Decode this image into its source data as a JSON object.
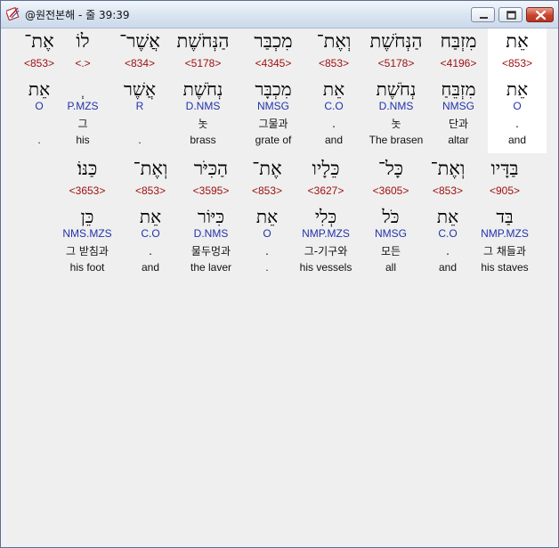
{
  "window": {
    "title": "@원전본해 - 줄 39:39",
    "colors": {
      "titlebar": "#dbe6f2",
      "content": "#efefef",
      "strong": "#a01010",
      "morph": "#2233aa"
    }
  },
  "rows": [
    {
      "words": [
        {
          "heb": "אֶת־",
          "strong": "<853>",
          "lemma": "אֵת",
          "morph": "O",
          "kor": "",
          "eng": ".",
          "selected": false
        },
        {
          "heb": "לוֹ",
          "strong": "<.>",
          "lemma": "ְ",
          "morph": "P.MZS",
          "kor": "그",
          "eng": "his",
          "selected": false
        },
        {
          "heb": "אֲשֶׁר־",
          "strong": "<834>",
          "lemma": "אֲשֶׁר",
          "morph": "R",
          "kor": "",
          "eng": ".",
          "selected": false
        },
        {
          "heb": "הַנְּחֹשֶׁת",
          "strong": "<5178>",
          "lemma": "נְחֹשֶׁת",
          "morph": "D.NMS",
          "kor": "놋",
          "eng": "brass",
          "selected": false
        },
        {
          "heb": "מִכְבַּר",
          "strong": "<4345>",
          "lemma": "מִכְבָּר",
          "morph": "NMSG",
          "kor": "그물과",
          "eng": "grate of",
          "selected": false
        },
        {
          "heb": "וְאֶת־",
          "strong": "<853>",
          "lemma": "אֵת",
          "morph": "C.O",
          "kor": ".",
          "eng": "and",
          "selected": false
        },
        {
          "heb": "הַנְּחֹשֶׁת",
          "strong": "<5178>",
          "lemma": "נְחֹשֶׁת",
          "morph": "D.NMS",
          "kor": "놋",
          "eng": "The brasen",
          "selected": false
        },
        {
          "heb": "מִזְבַּח",
          "strong": "<4196>",
          "lemma": "מִזְבֵּחַ",
          "morph": "NMSG",
          "kor": "단과",
          "eng": "altar",
          "selected": false
        },
        {
          "heb": "אֵת",
          "strong": "<853>",
          "lemma": "אֵת",
          "morph": "O",
          "kor": ".",
          "eng": "and",
          "selected": true
        }
      ]
    },
    {
      "words": [
        {
          "heb": "כַּנּוֹ׃",
          "strong": "<3653>",
          "lemma": "כֵּן",
          "morph": "NMS.MZS",
          "kor": "그 받침과",
          "eng": "his foot",
          "selected": false
        },
        {
          "heb": "וְאֶת־",
          "strong": "<853>",
          "lemma": "אֵת",
          "morph": "C.O",
          "kor": ".",
          "eng": "and",
          "selected": false
        },
        {
          "heb": "הַכִּיֹּר",
          "strong": "<3595>",
          "lemma": "כִּיּוֹר",
          "morph": "D.NMS",
          "kor": "물두멍과",
          "eng": "the laver",
          "selected": false
        },
        {
          "heb": "אֶת־",
          "strong": "<853>",
          "lemma": "אֵת",
          "morph": "O",
          "kor": ".",
          "eng": ".",
          "selected": false
        },
        {
          "heb": "כֵּלָיו",
          "strong": "<3627>",
          "lemma": "כְּלִי",
          "morph": "NMP.MZS",
          "kor": "그-기구와",
          "eng": "his vessels",
          "selected": false
        },
        {
          "heb": "כָּל־",
          "strong": "<3605>",
          "lemma": "כֹּל",
          "morph": "NMSG",
          "kor": "모든",
          "eng": "all",
          "selected": false
        },
        {
          "heb": "וְאֶת־",
          "strong": "<853>",
          "lemma": "אֵת",
          "morph": "C.O",
          "kor": ".",
          "eng": "and",
          "selected": false
        },
        {
          "heb": "בַּדָּיו",
          "strong": "<905>",
          "lemma": "בַּד",
          "morph": "NMP.MZS",
          "kor": "그 채들과",
          "eng": "his staves",
          "selected": false
        }
      ]
    }
  ]
}
